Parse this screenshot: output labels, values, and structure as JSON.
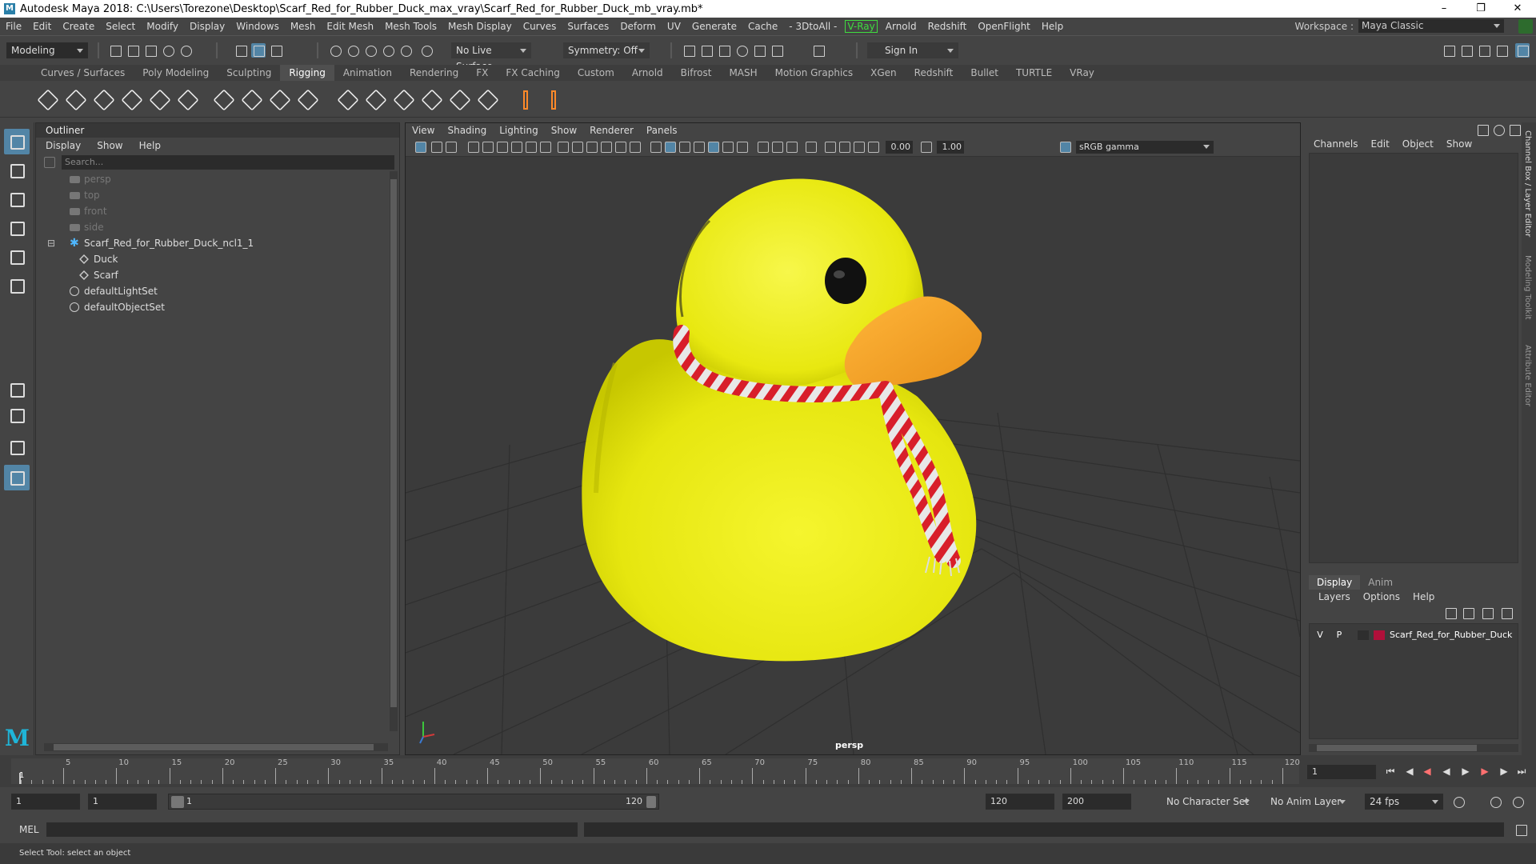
{
  "window": {
    "title": "Autodesk Maya 2018: C:\\Users\\Torezone\\Desktop\\Scarf_Red_for_Rubber_Duck_max_vray\\Scarf_Red_for_Rubber_Duck_mb_vray.mb*",
    "app_icon": "M"
  },
  "menubar": {
    "items": [
      "File",
      "Edit",
      "Create",
      "Select",
      "Modify",
      "Display",
      "Windows",
      "Mesh",
      "Edit Mesh",
      "Mesh Tools",
      "Mesh Display",
      "Curves",
      "Surfaces",
      "Deform",
      "UV",
      "Generate",
      "Cache",
      "- 3DtoAll -",
      "V-Ray",
      "Arnold",
      "Redshift",
      "OpenFlight",
      "Help"
    ],
    "workspace_label": "Workspace :",
    "workspace_value": "Maya Classic"
  },
  "statusline": {
    "menuset": "Modeling",
    "live_surface": "No Live Surface",
    "symmetry": "Symmetry: Off",
    "sign_in": "Sign In"
  },
  "shelf": {
    "tabs": [
      "Curves / Surfaces",
      "Poly Modeling",
      "Sculpting",
      "Rigging",
      "Animation",
      "Rendering",
      "FX",
      "FX Caching",
      "Custom",
      "Arnold",
      "Bifrost",
      "MASH",
      "Motion Graphics",
      "XGen",
      "Redshift",
      "Bullet",
      "TURTLE",
      "VRay"
    ],
    "active_tab": "Rigging"
  },
  "outliner": {
    "title": "Outliner",
    "menu": [
      "Display",
      "Show",
      "Help"
    ],
    "search_placeholder": "Search...",
    "items": [
      {
        "name": "persp",
        "type": "camera",
        "dim": true
      },
      {
        "name": "top",
        "type": "camera",
        "dim": true
      },
      {
        "name": "front",
        "type": "camera",
        "dim": true
      },
      {
        "name": "side",
        "type": "camera",
        "dim": true
      },
      {
        "name": "Scarf_Red_for_Rubber_Duck_ncl1_1",
        "type": "group",
        "dim": false
      },
      {
        "name": "Duck",
        "type": "mesh",
        "dim": false
      },
      {
        "name": "Scarf",
        "type": "mesh",
        "dim": false
      },
      {
        "name": "defaultLightSet",
        "type": "set",
        "dim": false
      },
      {
        "name": "defaultObjectSet",
        "type": "set",
        "dim": false
      }
    ]
  },
  "viewport": {
    "menu": [
      "View",
      "Shading",
      "Lighting",
      "Show",
      "Renderer",
      "Panels"
    ],
    "exposure": "0.00",
    "gamma": "1.00",
    "color_space": "sRGB gamma",
    "camera_label": "persp"
  },
  "channel_box": {
    "menu": [
      "Channels",
      "Edit",
      "Object",
      "Show"
    ]
  },
  "layer_editor": {
    "tabs": [
      "Display",
      "Anim"
    ],
    "menu": [
      "Layers",
      "Options",
      "Help"
    ],
    "layer": {
      "v": "V",
      "p": "P",
      "name": "Scarf_Red_for_Rubber_Duck",
      "color": "#b0103a"
    }
  },
  "side_tabs": [
    "Channel Box / Layer Editor",
    "Modeling Toolkit",
    "Attribute Editor"
  ],
  "timeline": {
    "labels": [
      "5",
      "10",
      "15",
      "20",
      "25",
      "30",
      "35",
      "40",
      "45",
      "50",
      "55",
      "60",
      "65",
      "70",
      "75",
      "80",
      "85",
      "90",
      "95",
      "100",
      "105",
      "110",
      "115",
      "120"
    ],
    "current_marker": "1",
    "current_frame": "1"
  },
  "range": {
    "start": "1",
    "playback_start": "1",
    "slider_left": "1",
    "slider_right": "120",
    "playback_end": "120",
    "end": "200",
    "character_set": "No Character Set",
    "anim_layer": "No Anim Layer",
    "fps": "24 fps"
  },
  "cmdline": {
    "label": "MEL"
  },
  "helpline": {
    "text": "Select Tool: select an object"
  }
}
